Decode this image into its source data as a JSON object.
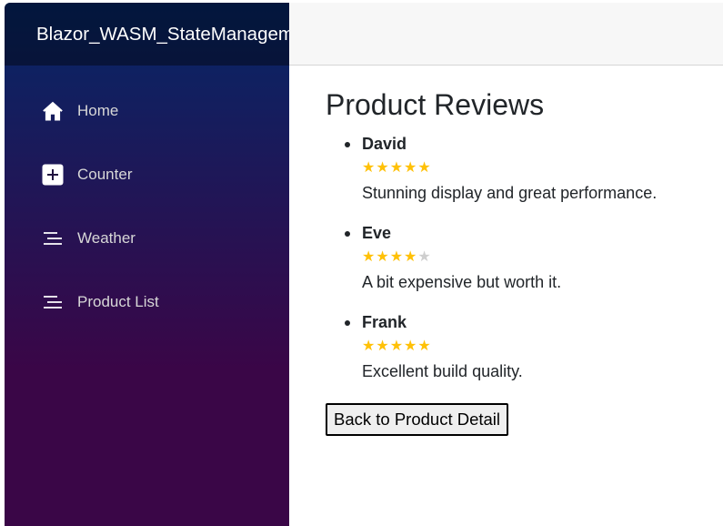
{
  "app": {
    "brand": "Blazor_WASM_StateManagement"
  },
  "sidebar": {
    "items": [
      {
        "label": "Home",
        "icon": "home-icon"
      },
      {
        "label": "Counter",
        "icon": "plus-square-icon"
      },
      {
        "label": "Weather",
        "icon": "list-icon"
      },
      {
        "label": "Product List",
        "icon": "list-icon"
      }
    ]
  },
  "main": {
    "title": "Product Reviews",
    "reviews": [
      {
        "name": "David",
        "rating": 5,
        "max_rating": 5,
        "comment": "Stunning display and great performance."
      },
      {
        "name": "Eve",
        "rating": 4,
        "max_rating": 5,
        "comment": "A bit expensive but worth it."
      },
      {
        "name": "Frank",
        "rating": 5,
        "max_rating": 5,
        "comment": "Excellent build quality."
      }
    ],
    "back_button": "Back to Product Detail"
  },
  "colors": {
    "sidebar_top": "#052767",
    "sidebar_bottom": "#3a0647",
    "star_filled": "#ffc107",
    "star_empty": "#cfcfcf"
  }
}
